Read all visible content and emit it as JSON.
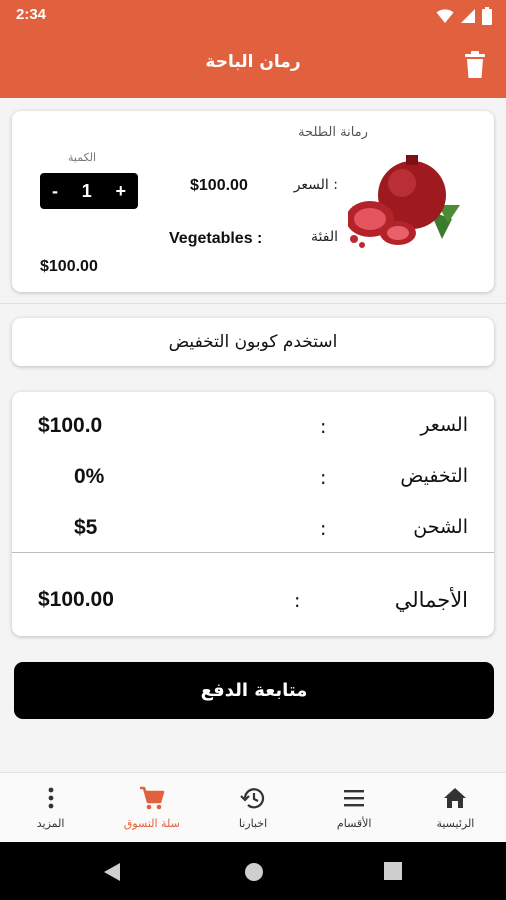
{
  "status_bar": {
    "time": "2:34"
  },
  "app_bar": {
    "title": "رمان الباحة",
    "delete_icon": "trash-icon"
  },
  "colors": {
    "accent": "#e1613e",
    "dark": "#000000"
  },
  "cart_item": {
    "name": "رمانة الطلحة",
    "price_label": "السعر :",
    "price_value": "$100.00",
    "category_label": "الفئة",
    "category_value": "Vegetables :",
    "quantity_label": "الكمية",
    "quantity": "1",
    "minus": "-",
    "plus": "+",
    "line_total": "$100.00"
  },
  "coupon": {
    "label": "استخدم كوبون التخفيض"
  },
  "summary": {
    "colon": ":",
    "rows": [
      {
        "label": "السعر",
        "value": "$100.0"
      },
      {
        "label": "التخفيض",
        "value": "0%"
      },
      {
        "label": "الشحن",
        "value": "$5"
      }
    ],
    "total_label": "الأجمالي",
    "total_value": "$100.00"
  },
  "checkout": {
    "label": "متابعة الدفع"
  },
  "bottom_nav": {
    "items": [
      {
        "label": "المزيد",
        "icon": "more-vert-icon"
      },
      {
        "label": "سلة التسوق",
        "icon": "cart-icon",
        "active": true
      },
      {
        "label": "اخبارنا",
        "icon": "history-icon"
      },
      {
        "label": "الأقسام",
        "icon": "menu-icon"
      },
      {
        "label": "الرئيسية",
        "icon": "home-icon"
      }
    ]
  }
}
